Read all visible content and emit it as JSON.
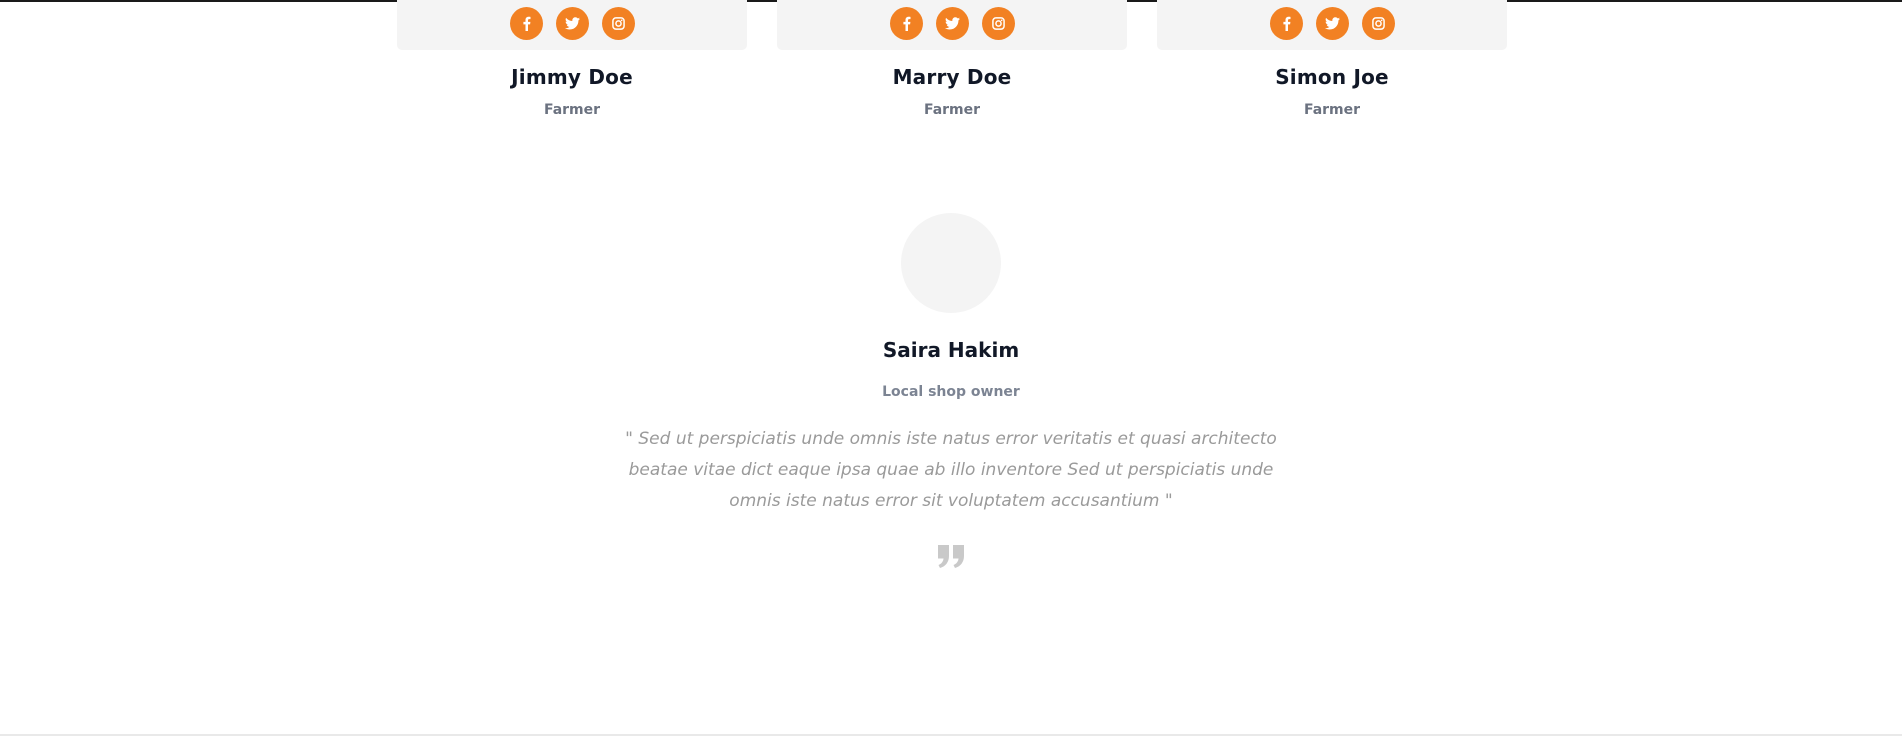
{
  "team": [
    {
      "name": "Jimmy Doe",
      "role": "Farmer",
      "socials": [
        "facebook-icon",
        "twitter-icon",
        "instagram-icon"
      ]
    },
    {
      "name": "Marry Doe",
      "role": "Farmer",
      "socials": [
        "facebook-icon",
        "twitter-icon",
        "instagram-icon"
      ]
    },
    {
      "name": "Simon Joe",
      "role": "Farmer",
      "socials": [
        "facebook-icon",
        "twitter-icon",
        "instagram-icon"
      ]
    }
  ],
  "testimonial": {
    "name": "Saira Hakim",
    "role": "Local shop owner",
    "quote": "\" Sed ut perspiciatis unde omnis iste natus error veritatis et quasi architecto beatae vitae dict eaque ipsa quae ab illo inventore Sed ut perspiciatis unde omnis iste natus error sit voluptatem accusantium \"",
    "quote_icon": "quote-icon"
  },
  "colors": {
    "accent": "#f28123",
    "card_bg": "#f4f4f4",
    "heading": "#111827",
    "muted": "#6b7280",
    "quote_text": "#9a9a9a"
  }
}
